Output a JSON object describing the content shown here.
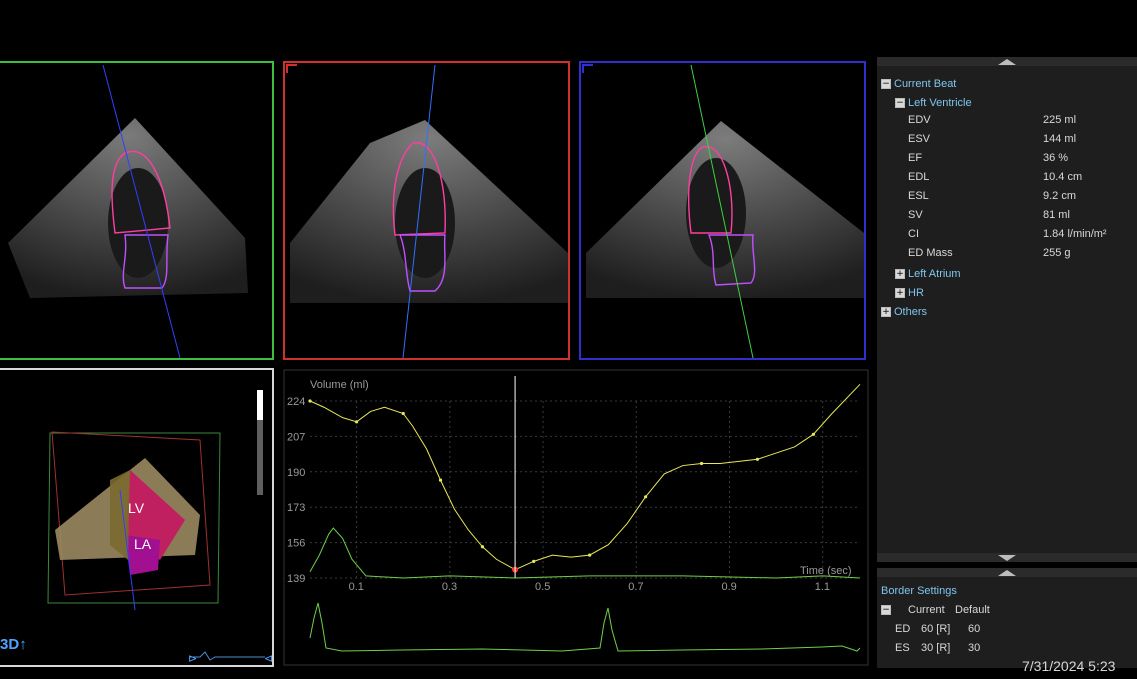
{
  "views": {
    "label_3d": "3D",
    "label_lv": "LV",
    "label_la": "LA"
  },
  "chart_data": {
    "type": "line",
    "ylabel": "Volume (ml)",
    "xlabel": "Time (sec)",
    "yticks": [
      139,
      156,
      173,
      190,
      207,
      224
    ],
    "xticks": [
      0.1,
      0.3,
      0.5,
      0.7,
      0.9,
      1.1
    ],
    "xlim": [
      0.0,
      1.18
    ],
    "ylim": [
      139,
      224
    ],
    "cursor_x": 0.44,
    "grid": true,
    "series": [
      {
        "values": [
          [
            0.0,
            224
          ],
          [
            0.03,
            221
          ],
          [
            0.07,
            216
          ],
          [
            0.1,
            214
          ],
          [
            0.13,
            219
          ],
          [
            0.16,
            221
          ],
          [
            0.2,
            218
          ],
          [
            0.22,
            212
          ],
          [
            0.25,
            201
          ],
          [
            0.28,
            186
          ],
          [
            0.31,
            172
          ],
          [
            0.34,
            162
          ],
          [
            0.37,
            154
          ],
          [
            0.4,
            148
          ],
          [
            0.44,
            143
          ],
          [
            0.48,
            147
          ],
          [
            0.52,
            150
          ],
          [
            0.56,
            149
          ],
          [
            0.6,
            150
          ],
          [
            0.64,
            155
          ],
          [
            0.68,
            165
          ],
          [
            0.72,
            178
          ],
          [
            0.76,
            189
          ],
          [
            0.8,
            193
          ],
          [
            0.84,
            194
          ],
          [
            0.88,
            194
          ],
          [
            0.92,
            195
          ],
          [
            0.96,
            196
          ],
          [
            1.0,
            199
          ],
          [
            1.04,
            202
          ],
          [
            1.08,
            208
          ],
          [
            1.12,
            218
          ],
          [
            1.18,
            236
          ]
        ]
      },
      {
        "values": [
          [
            0.0,
            142
          ],
          [
            0.02,
            150
          ],
          [
            0.04,
            160
          ],
          [
            0.05,
            163
          ],
          [
            0.07,
            158
          ],
          [
            0.09,
            148
          ],
          [
            0.12,
            140
          ],
          [
            0.2,
            139
          ],
          [
            0.3,
            140
          ],
          [
            0.44,
            139
          ],
          [
            0.6,
            140
          ],
          [
            0.8,
            140
          ],
          [
            1.0,
            139
          ],
          [
            1.1,
            140
          ],
          [
            1.18,
            139
          ]
        ]
      }
    ]
  },
  "side_panel": {
    "current_beat": "Current Beat",
    "left_ventricle": "Left Ventricle",
    "measurements": [
      {
        "label": "EDV",
        "value": "225 ml"
      },
      {
        "label": "ESV",
        "value": "144 ml"
      },
      {
        "label": "EF",
        "value": "36 %"
      },
      {
        "label": "EDL",
        "value": "10.4 cm"
      },
      {
        "label": "ESL",
        "value": "9.2 cm"
      },
      {
        "label": "SV",
        "value": "81 ml"
      },
      {
        "label": "CI",
        "value": "1.84 l/min/m²"
      },
      {
        "label": "ED Mass",
        "value": "255 g"
      }
    ],
    "left_atrium": "Left Atrium",
    "hr": "HR",
    "others": "Others"
  },
  "border_settings": {
    "title": "Border Settings",
    "col_current": "Current",
    "col_default": "Default",
    "rows": [
      {
        "label": "ED",
        "current": "60 [R]",
        "default": "60"
      },
      {
        "label": "ES",
        "current": "30 [R]",
        "default": "30"
      }
    ]
  },
  "datetime": "7/31/2024 5:23",
  "colors": {
    "view1_border": "#3fbf3f",
    "view2_border": "#d03030",
    "view3_border": "#3030d0",
    "accent_text": "#7fc6ef",
    "volume_curve": "#e8e85a",
    "ecg_curve": "#6fd04a"
  }
}
